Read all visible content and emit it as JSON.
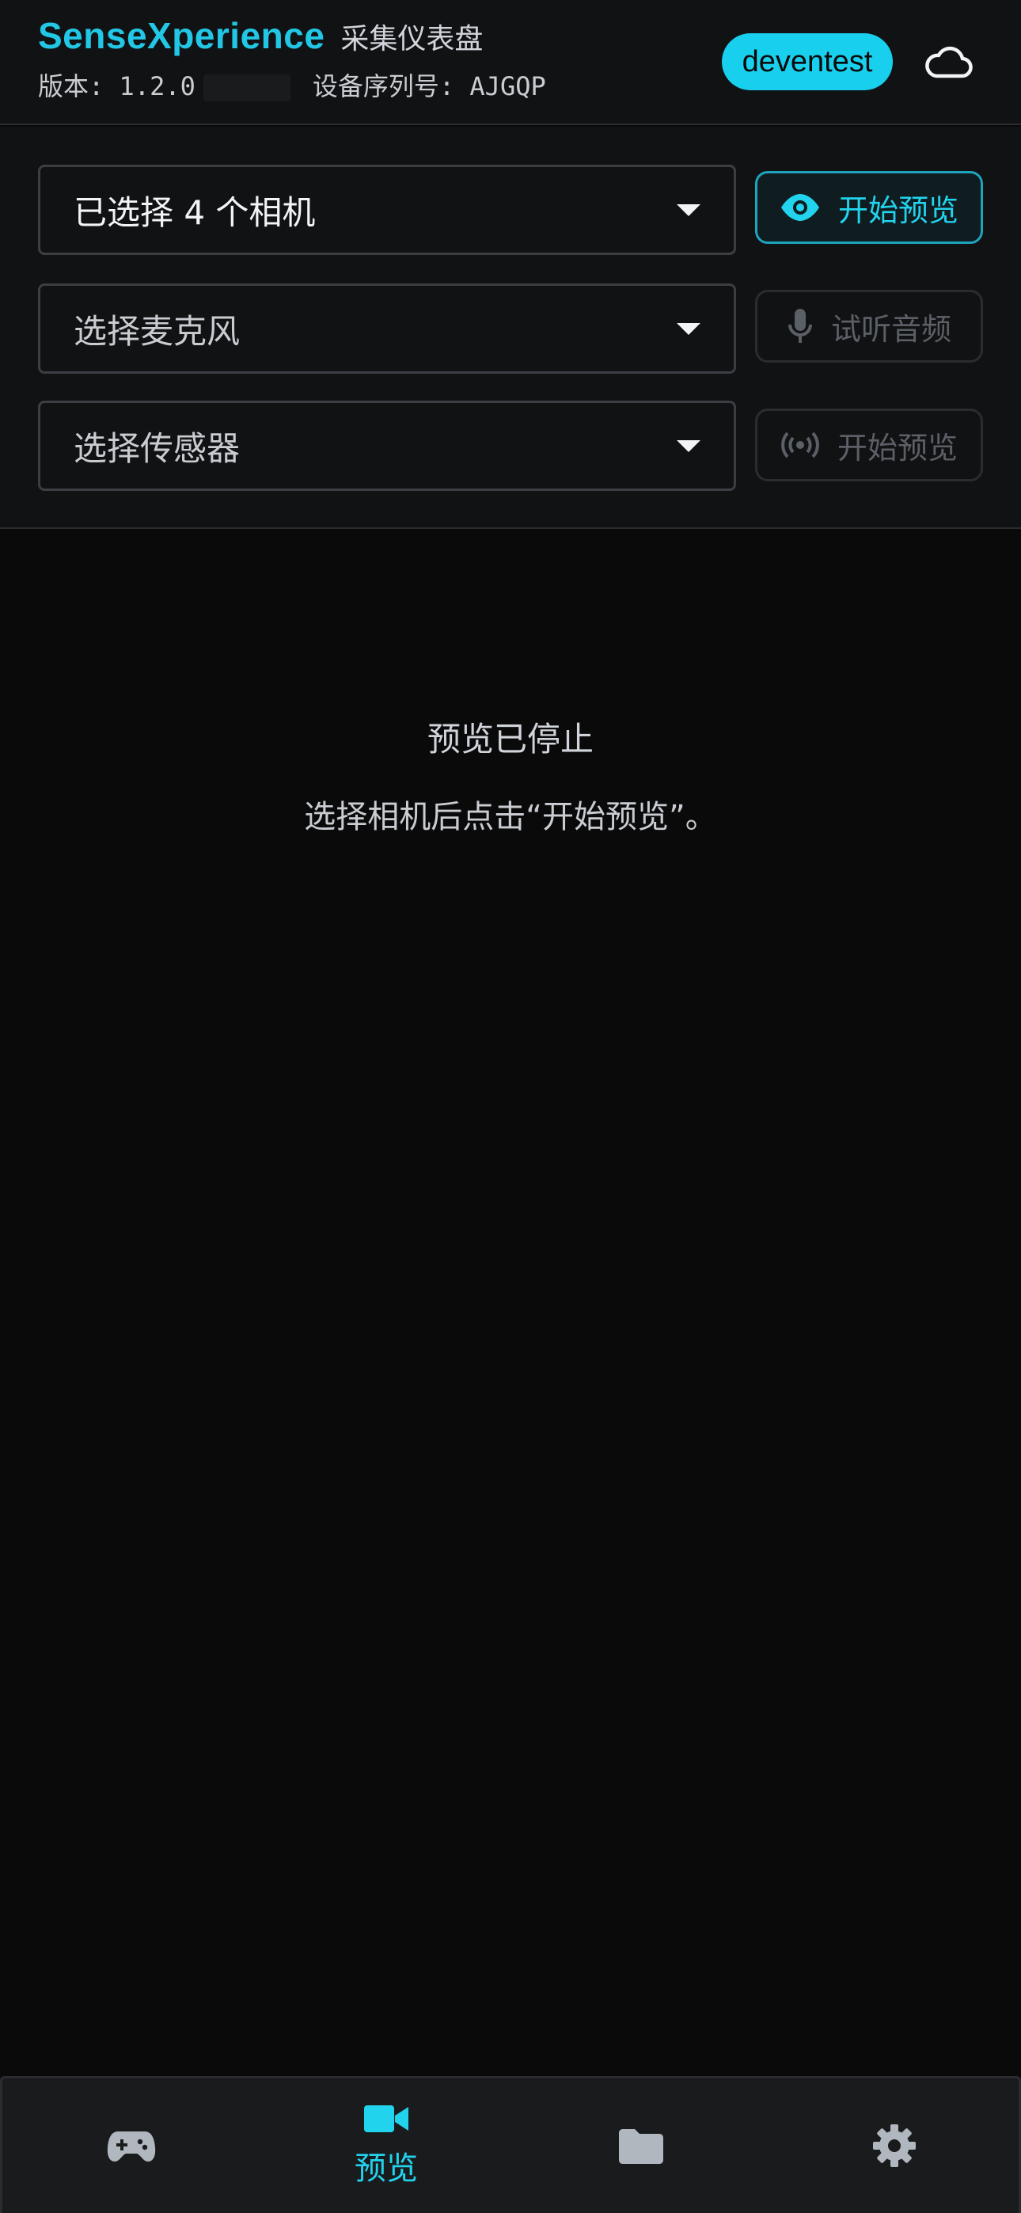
{
  "header": {
    "brand": "SenseXperience",
    "subtitle": "采集仪表盘",
    "version_label": "版本: 1.2.0",
    "serial_label": "设备序列号: AJGQP",
    "user": "deventest"
  },
  "controls": {
    "camera_select": {
      "value": "已选择 4 个相机"
    },
    "camera_preview_button": {
      "label": "开始预览"
    },
    "mic_select": {
      "placeholder": "选择麦克风"
    },
    "mic_listen_button": {
      "label": "试听音频"
    },
    "sensor_select": {
      "placeholder": "选择传感器"
    },
    "sensor_preview_button": {
      "label": "开始预览"
    }
  },
  "preview": {
    "title": "预览已停止",
    "hint": "选择相机后点击“开始预览”。"
  },
  "nav": {
    "items": [
      {
        "icon": "gamepad-icon",
        "label": ""
      },
      {
        "icon": "video-camera-icon",
        "label": "预览",
        "active": true
      },
      {
        "icon": "folder-icon",
        "label": ""
      },
      {
        "icon": "gear-icon",
        "label": ""
      }
    ]
  },
  "colors": {
    "accent": "#22d3ee",
    "background": "#0a0a0b",
    "panel": "#111213",
    "border": "#3b3e43"
  }
}
